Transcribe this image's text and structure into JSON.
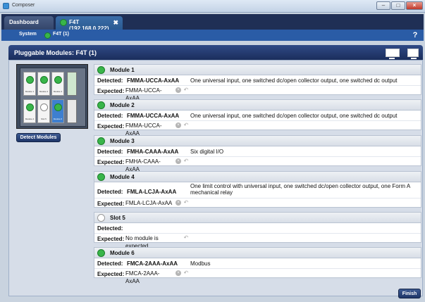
{
  "window": {
    "title": "Composer"
  },
  "tabs": [
    {
      "label": "Dashboard"
    },
    {
      "label": "F4T (192.168.0.222)"
    }
  ],
  "breadcrumb": {
    "system": "System",
    "device": "F4T (1)"
  },
  "panel": {
    "title": "Pluggable Modules: F4T (1)"
  },
  "graphic": {
    "slot_labels": [
      "Module 1",
      "Module 2",
      "Module 3",
      "Module 4",
      "Slot 5",
      "Module 6"
    ]
  },
  "detect_label": "Detect Modules",
  "modules": [
    {
      "title": "Module 1",
      "detected_label": "Detected:",
      "detected": "FMMA-UCCA-AxAA",
      "description": "One universal input, one switched dc/open collector output, one switched dc output",
      "expected_label": "Expected:",
      "expected": "FMMA-UCCA-AxAA"
    },
    {
      "title": "Module 2",
      "detected_label": "Detected:",
      "detected": "FMMA-UCCA-AxAA",
      "description": "One universal input, one switched dc/open collector output, one switched dc output",
      "expected_label": "Expected:",
      "expected": "FMMA-UCCA-AxAA"
    },
    {
      "title": "Module 3",
      "detected_label": "Detected:",
      "detected": "FMHA-CAAA-AxAA",
      "description": "Six digital I/O",
      "expected_label": "Expected:",
      "expected": "FMHA-CAAA-AxAA"
    },
    {
      "title": "Module 4",
      "detected_label": "Detected:",
      "detected": "FMLA-LCJA-AxAA",
      "description": "One limit control with universal input, one switched dc/open collector output, one Form A mechanical relay",
      "expected_label": "Expected:",
      "expected": "FMLA-LCJA-AxAA"
    },
    {
      "title": "Slot 5",
      "detected_label": "Detected:",
      "detected": "",
      "description": "",
      "expected_label": "Expected:",
      "expected": "No module is expected"
    },
    {
      "title": "Module 6",
      "detected_label": "Detected:",
      "detected": "FMCA-2AAA-AxAA",
      "description": "Modbus",
      "expected_label": "Expected:",
      "expected": "FMCA-2AAA-AxAA"
    }
  ],
  "finish_label": "Finish",
  "colors": {
    "header": "#1f2f55",
    "accent": "#2a5ca6",
    "status_ok": "#39b54a"
  }
}
